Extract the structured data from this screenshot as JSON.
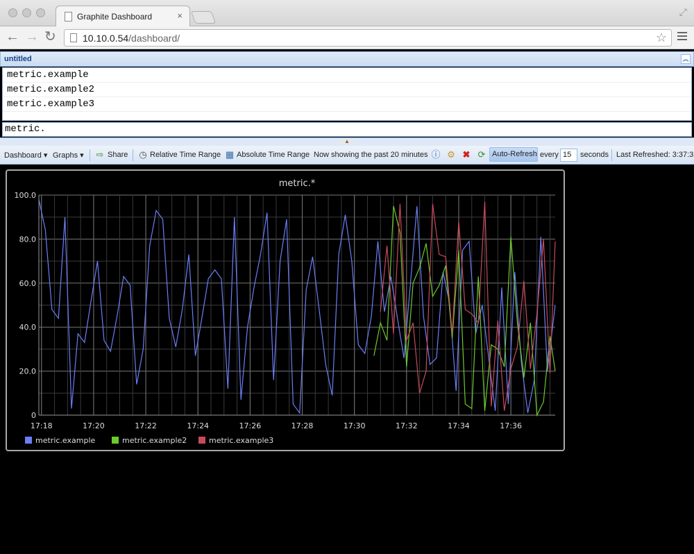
{
  "browser": {
    "tab_title": "Graphite Dashboard",
    "url_host": "10.10.0.54",
    "url_path": "/dashboard/"
  },
  "panel": {
    "title": "untitled",
    "metrics": [
      "metric.example",
      "metric.example2",
      "metric.example3"
    ],
    "input_value": "metric."
  },
  "toolbar": {
    "dashboard": "Dashboard",
    "graphs": "Graphs",
    "share": "Share",
    "relative_time": "Relative Time Range",
    "absolute_time": "Absolute Time Range",
    "showing": "Now showing the past 20 minutes",
    "auto_refresh": "Auto-Refresh",
    "every": "every",
    "interval": "15",
    "seconds": "seconds",
    "last_refreshed": "Last Refreshed: 3:37:3"
  },
  "chart_data": {
    "type": "line",
    "title": "metric.*",
    "ylim": [
      0,
      100
    ],
    "y_ticks": [
      "100.0",
      "80.0",
      "60.0",
      "40.0",
      "20.0",
      "0"
    ],
    "x_ticks": [
      "17:18",
      "17:20",
      "17:22",
      "17:24",
      "17:26",
      "17:28",
      "17:30",
      "17:32",
      "17:34",
      "17:36"
    ],
    "x_start_minute": 17.9,
    "x_end_minute": 37.7,
    "grid": true,
    "legend_position": "bottom-left",
    "series": [
      {
        "name": "metric.example",
        "color": "#6b7ff7",
        "t": [
          17.9,
          18.15,
          18.4,
          18.65,
          18.9,
          19.15,
          19.4,
          19.65,
          19.9,
          20.15,
          20.4,
          20.65,
          20.9,
          21.15,
          21.4,
          21.65,
          21.9,
          22.15,
          22.4,
          22.65,
          22.9,
          23.15,
          23.4,
          23.65,
          23.9,
          24.15,
          24.4,
          24.65,
          24.9,
          25.15,
          25.4,
          25.65,
          25.9,
          26.15,
          26.4,
          26.65,
          26.9,
          27.15,
          27.4,
          27.65,
          27.9,
          28.15,
          28.4,
          28.65,
          28.9,
          29.15,
          29.4,
          29.65,
          29.9,
          30.15,
          30.4,
          30.65,
          30.9,
          31.15,
          31.4,
          31.65,
          31.9,
          32.15,
          32.4,
          32.65,
          32.9,
          33.15,
          33.4,
          33.65,
          33.9,
          34.15,
          34.4,
          34.65,
          34.9,
          35.15,
          35.4,
          35.65,
          35.9,
          36.15,
          36.4,
          36.65,
          36.9,
          37.15,
          37.4,
          37.7
        ],
        "values": [
          98,
          84,
          48,
          44,
          90,
          3,
          37,
          33,
          52,
          70,
          34,
          29,
          45,
          63,
          59,
          14,
          30,
          77,
          93,
          89,
          44,
          31,
          48,
          73,
          27,
          44,
          62,
          66,
          62,
          12,
          90,
          7,
          40,
          58,
          73,
          92,
          16,
          70,
          89,
          5,
          1,
          57,
          72,
          48,
          23,
          9,
          73,
          91,
          70,
          32,
          28,
          45,
          79,
          47,
          63,
          44,
          26,
          60,
          95,
          45,
          23,
          26,
          65,
          51,
          11,
          75,
          79,
          37,
          50,
          26,
          2,
          58,
          5,
          65,
          24,
          1,
          16,
          81,
          20,
          50
        ]
      },
      {
        "name": "metric.example2",
        "color": "#6ccc2c",
        "t": [
          30.75,
          31.0,
          31.25,
          31.5,
          31.75,
          32.0,
          32.25,
          32.5,
          32.75,
          33.0,
          33.25,
          33.5,
          33.75,
          34.0,
          34.25,
          34.5,
          34.75,
          35.0,
          35.25,
          35.5,
          35.75,
          36.0,
          36.25,
          36.5,
          36.75,
          37.0,
          37.25,
          37.5,
          37.7
        ],
        "values": [
          27,
          42,
          34,
          95,
          83,
          22,
          60,
          67,
          78,
          54,
          59,
          68,
          35,
          75,
          5,
          3,
          63,
          2,
          32,
          30,
          22,
          81,
          42,
          17,
          42,
          0,
          6,
          36,
          20
        ]
      },
      {
        "name": "metric.example3",
        "color": "#c94a5c",
        "t": [
          31.0,
          31.25,
          31.5,
          31.75,
          32.0,
          32.25,
          32.5,
          32.75,
          33.0,
          33.25,
          33.5,
          33.75,
          34.0,
          34.25,
          34.5,
          34.75,
          35.0,
          35.25,
          35.5,
          35.75,
          36.0,
          36.25,
          36.5,
          36.75,
          37.0,
          37.25,
          37.5,
          37.7
        ],
        "values": [
          47,
          77,
          37,
          96,
          34,
          42,
          10,
          20,
          96,
          73,
          72,
          37,
          88,
          48,
          46,
          42,
          97,
          4,
          43,
          2,
          21,
          31,
          61,
          21,
          46,
          80,
          19,
          79
        ]
      }
    ]
  }
}
